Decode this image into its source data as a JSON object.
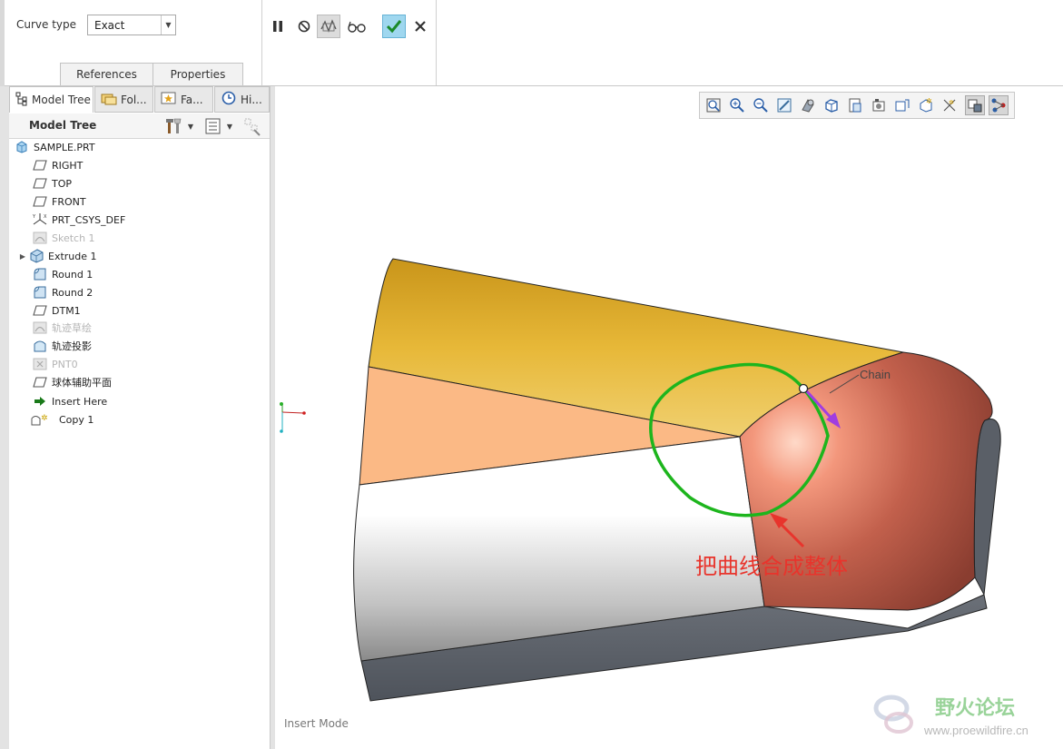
{
  "dashboard": {
    "curve_type_label": "Curve type",
    "curve_type_value": "Exact",
    "tabs": [
      "References",
      "Properties"
    ],
    "actions": [
      "pause-icon",
      "no-preview-icon",
      "verify-icon",
      "glasses-icon",
      "ok-icon",
      "cancel-icon"
    ]
  },
  "panel": {
    "tabs": [
      {
        "label": "Model Tree",
        "icon": "model-tree-icon"
      },
      {
        "label": "Fol...",
        "icon": "folder-browser-icon"
      },
      {
        "label": "Fa...",
        "icon": "favorites-icon"
      },
      {
        "label": "Hi...",
        "icon": "history-icon"
      }
    ],
    "header_title": "Model Tree"
  },
  "tree": [
    {
      "label": "SAMPLE.PRT",
      "icon": "part-icon",
      "dim": false
    },
    {
      "label": "RIGHT",
      "icon": "datum-plane-icon",
      "dim": false
    },
    {
      "label": "TOP",
      "icon": "datum-plane-icon",
      "dim": false
    },
    {
      "label": "FRONT",
      "icon": "datum-plane-icon",
      "dim": false
    },
    {
      "label": "PRT_CSYS_DEF",
      "icon": "csys-icon",
      "dim": false
    },
    {
      "label": "Sketch 1",
      "icon": "sketch-icon",
      "dim": true
    },
    {
      "label": "Extrude 1",
      "icon": "extrude-icon",
      "dim": false
    },
    {
      "label": "Round 1",
      "icon": "round-icon",
      "dim": false
    },
    {
      "label": "Round 2",
      "icon": "round-icon",
      "dim": false
    },
    {
      "label": "DTM1",
      "icon": "datum-plane-icon",
      "dim": false
    },
    {
      "label": "轨迹草绘",
      "icon": "sketch-icon",
      "dim": true
    },
    {
      "label": "轨迹投影",
      "icon": "projected-curve-icon",
      "dim": false
    },
    {
      "label": "PNT0",
      "icon": "datum-point-icon",
      "dim": true
    },
    {
      "label": "球体辅助平面",
      "icon": "datum-plane-icon",
      "dim": false
    },
    {
      "label": "Insert Here",
      "icon": "insert-arrow-icon",
      "dim": false
    },
    {
      "label": "Copy 1",
      "icon": "copy-icon",
      "dim": false
    }
  ],
  "graphics": {
    "chain_label": "Chain",
    "annotation": "把曲线合成整体",
    "status": "Insert Mode",
    "view_tools": [
      "refit-icon",
      "zoom-in-icon",
      "zoom-out-icon",
      "repaint-icon",
      "display-style-icon",
      "saved-views-icon",
      "view-manager-icon",
      "perspective-icon",
      "section-icon",
      "datum-display-icon",
      "annotation-display-icon",
      "spin-center-icon",
      "selected-filter-icon"
    ]
  },
  "watermark": {
    "title": "野火论坛",
    "url": "www.proewildfire.cn"
  },
  "colors": {
    "curve": "#1db51d",
    "annotation": "#e8342c",
    "chain_arrow": "#a03de0",
    "gold_face": "#e8b530",
    "copper_face": "#c8705a"
  }
}
